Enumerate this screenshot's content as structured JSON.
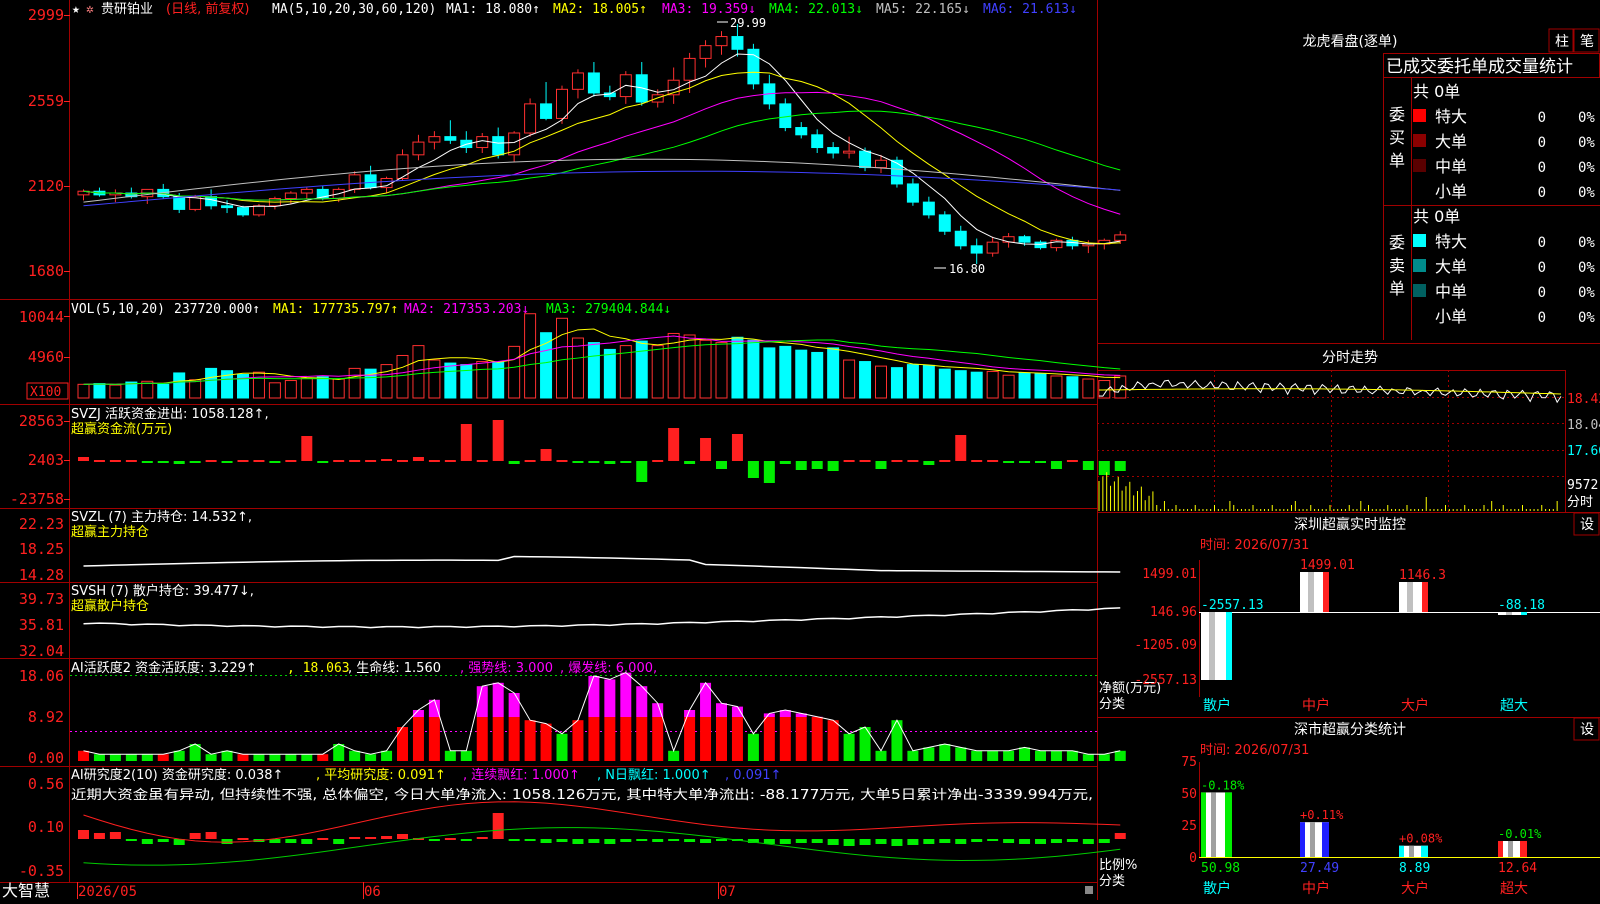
{
  "colors": {
    "up": "#ff3030",
    "down": "#00ffff",
    "grid": "#a00000",
    "label_red": "#ff2020",
    "ma1": "#ffffff",
    "ma2": "#ffff00",
    "ma3": "#ff00ff",
    "ma4": "#00ff00",
    "ma5": "#c0c0c0",
    "ma6": "#4040ff",
    "green_bar": "#00ee00"
  },
  "icons": {
    "star": "★",
    "gear": "✲"
  },
  "header": {
    "name": "贵研铂业",
    "period": "(日线, 前复权)",
    "ma_params": "MA(5,10,20,30,60,120)",
    "ma1": "MA1: 18.080↑",
    "ma2": "MA2: 18.005↑",
    "ma3": "MA3: 19.359↓",
    "ma4": "MA4: 22.013↓",
    "ma5": "MA5: 22.165↓",
    "ma6": "MA6: 21.613↓"
  },
  "price_axis": [
    "2999",
    "2559",
    "2120",
    "1680"
  ],
  "price_marks": {
    "high": "29.99",
    "low": "16.80"
  },
  "vol_panel": {
    "title": "VOL(5,10,20)",
    "v0": "237720.000↑",
    "ma1": "MA1: 177735.797↑",
    "ma2": "MA2: 217353.203↓",
    "ma3": "MA3: 279404.844↓",
    "axis": [
      "10044",
      "4960"
    ],
    "unit": "X100"
  },
  "svzj_panel": {
    "title": "SVZJ  活跃资金进出: 1058.128↑,",
    "subtitle": "超赢资金流(万元)",
    "axis": [
      "28563",
      "2403",
      "-23758"
    ]
  },
  "svzl_panel": {
    "title": "SVZL (7) 主力持仓: 14.532↑,",
    "subtitle": "超赢主力持仓",
    "axis": [
      "22.23",
      "18.25",
      "14.28"
    ]
  },
  "svsh_panel": {
    "title": "SVSH (7) 散户持仓: 39.477↓,",
    "subtitle": "超赢散户持仓",
    "axis": [
      "39.73",
      "35.81",
      "32.04"
    ]
  },
  "ai1_panel": {
    "title": "AI活跃度2 资金活跃度: 3.229↑",
    "v2": ", 18.063",
    "v3": ", 生命线: 1.560",
    "v4": ", 强势线: 3.000",
    "v5": ", 爆发线: 6.000,",
    "axis": [
      "18.06",
      "8.92",
      "0.00"
    ]
  },
  "ai2_panel": {
    "title": "AI研究度2(10) 资金研究度: 0.038↑",
    "v2": ", 平均研究度: 0.091↑",
    "v3": ", 连续飘红: 1.000↑",
    "v4": ", N日飘红: 1.000↑",
    "v5": ", 0.091↑",
    "comment": "近期大资金虽有异动, 但持续性不强, 总体偏空, 今日大单净流入: 1058.126万元, 其中特大单净流出: -88.177万元, 大单5日累计净出-3339.994万元, ",
    "axis": [
      "0.56",
      "0.10",
      "-0.35"
    ]
  },
  "bottom_bar": {
    "brand": "大智慧",
    "dates": [
      "2026/05",
      "06",
      "07"
    ]
  },
  "lhb": {
    "title": "龙虎看盘(逐单)",
    "btn1": "柱",
    "btn2": "笔",
    "subtitle": "已成交委托单成交量统计",
    "buy_label": "委买单",
    "sell_label": "委卖单",
    "buy_total": "共 0单",
    "sell_total": "共 0单",
    "buy_rows": [
      {
        "label": "特大",
        "count": "0",
        "pct": "0%"
      },
      {
        "label": "大单",
        "count": "0",
        "pct": "0%"
      },
      {
        "label": "中单",
        "count": "0",
        "pct": "0%"
      },
      {
        "label": "小单",
        "count": "0",
        "pct": "0%"
      }
    ],
    "sell_rows": [
      {
        "label": "特大",
        "count": "0",
        "pct": "0%"
      },
      {
        "label": "大单",
        "count": "0",
        "pct": "0%"
      },
      {
        "label": "中单",
        "count": "0",
        "pct": "0%"
      },
      {
        "label": "小单",
        "count": "0",
        "pct": "0%"
      }
    ]
  },
  "intraday": {
    "title": "分时走势",
    "axis": [
      "18.42",
      "18.04",
      "17.66"
    ],
    "vol_label": "9572",
    "vol_unit": "分时"
  },
  "sz_monitor": {
    "title": "深圳超赢实时监控",
    "btn": "设",
    "time": "时间: 2026/07/31",
    "axis": [
      "1499.01",
      "146.96",
      "-1205.09",
      "-2557.13"
    ],
    "y_label": "净额(万元)",
    "x_label": "分类",
    "cats": [
      "散户",
      "中户",
      "大户",
      "超大"
    ],
    "value_labels": [
      "-2557.13",
      "1499.01",
      "1146.3",
      "-88.18"
    ]
  },
  "sz_class": {
    "title": "深市超赢分类统计",
    "btn": "设",
    "time": "时间: 2026/07/31",
    "axis": [
      "75",
      "50",
      "25",
      "0"
    ],
    "y_label": "比例%",
    "x_label": "分类",
    "cats": [
      "散户",
      "中户",
      "大户",
      "超大"
    ],
    "pct_labels": [
      "-0.18%",
      "+0.11%",
      "+0.08%",
      "-0.01%"
    ],
    "value_labels": [
      "50.98",
      "27.49",
      "8.89",
      "12.64"
    ]
  },
  "chart_data": [
    {
      "type": "candlestick",
      "title": "贵研铂业 (日线, 前复权)",
      "ylim": [
        16.8,
        29.99
      ],
      "x_ticks": [
        "2026/05",
        "06",
        "07"
      ],
      "ohlc": [
        [
          20.6,
          20.9,
          20.3,
          20.8
        ],
        [
          20.8,
          21.0,
          20.5,
          20.6
        ],
        [
          20.6,
          20.9,
          20.2,
          20.7
        ],
        [
          20.7,
          21.0,
          20.4,
          20.5
        ],
        [
          20.5,
          20.9,
          20.1,
          20.9
        ],
        [
          20.9,
          21.2,
          20.4,
          20.5
        ],
        [
          20.5,
          20.7,
          19.6,
          19.8
        ],
        [
          19.8,
          20.6,
          19.7,
          20.5
        ],
        [
          20.5,
          20.9,
          19.8,
          20.0
        ],
        [
          20.0,
          20.3,
          19.6,
          19.9
        ],
        [
          19.9,
          20.0,
          19.4,
          19.5
        ],
        [
          19.5,
          20.1,
          19.4,
          20.0
        ],
        [
          20.0,
          20.5,
          19.8,
          20.4
        ],
        [
          20.4,
          20.8,
          20.1,
          20.7
        ],
        [
          20.7,
          21.0,
          20.4,
          20.9
        ],
        [
          20.9,
          21.1,
          20.3,
          20.4
        ],
        [
          20.4,
          21.0,
          20.2,
          20.9
        ],
        [
          20.9,
          21.9,
          20.7,
          21.7
        ],
        [
          21.7,
          22.2,
          20.9,
          21.0
        ],
        [
          21.0,
          21.6,
          20.7,
          21.5
        ],
        [
          21.5,
          23.1,
          21.4,
          22.8
        ],
        [
          22.8,
          23.9,
          22.5,
          23.5
        ],
        [
          23.5,
          24.1,
          23.1,
          23.8
        ],
        [
          23.8,
          24.7,
          23.4,
          23.6
        ],
        [
          23.6,
          24.1,
          22.9,
          23.2
        ],
        [
          23.2,
          24.0,
          22.9,
          23.8
        ],
        [
          23.8,
          24.3,
          22.6,
          22.8
        ],
        [
          22.8,
          24.1,
          22.4,
          24.0
        ],
        [
          24.0,
          25.9,
          23.8,
          25.6
        ],
        [
          25.6,
          26.8,
          24.7,
          24.8
        ],
        [
          24.8,
          26.6,
          24.5,
          26.4
        ],
        [
          26.4,
          27.5,
          25.9,
          27.3
        ],
        [
          27.3,
          27.9,
          26.0,
          26.2
        ],
        [
          26.2,
          26.6,
          25.8,
          26.0
        ],
        [
          26.0,
          27.4,
          25.6,
          27.2
        ],
        [
          27.2,
          27.9,
          25.5,
          25.7
        ],
        [
          25.7,
          26.4,
          25.4,
          26.1
        ],
        [
          26.1,
          27.6,
          25.6,
          26.9
        ],
        [
          26.9,
          28.4,
          26.2,
          28.1
        ],
        [
          28.1,
          29.1,
          27.6,
          28.8
        ],
        [
          28.8,
          29.6,
          28.3,
          29.3
        ],
        [
          29.3,
          29.99,
          28.2,
          28.6
        ],
        [
          28.6,
          28.9,
          26.4,
          26.7
        ],
        [
          26.7,
          27.2,
          25.3,
          25.6
        ],
        [
          25.6,
          25.9,
          24.1,
          24.3
        ],
        [
          24.3,
          24.6,
          23.7,
          23.9
        ],
        [
          23.9,
          24.2,
          22.9,
          23.2
        ],
        [
          23.2,
          23.5,
          22.6,
          22.9
        ],
        [
          22.9,
          23.8,
          22.6,
          23.0
        ],
        [
          23.0,
          23.2,
          21.9,
          22.1
        ],
        [
          22.1,
          22.8,
          21.8,
          22.5
        ],
        [
          22.5,
          22.7,
          21.0,
          21.2
        ],
        [
          21.2,
          21.5,
          20.0,
          20.2
        ],
        [
          20.2,
          20.5,
          19.3,
          19.5
        ],
        [
          19.5,
          19.7,
          18.4,
          18.6
        ],
        [
          18.6,
          18.9,
          17.6,
          17.8
        ],
        [
          17.8,
          18.2,
          16.8,
          17.4
        ],
        [
          17.4,
          18.3,
          17.2,
          18.0
        ],
        [
          18.0,
          18.5,
          17.7,
          18.3
        ],
        [
          18.3,
          18.4,
          17.8,
          18.0
        ],
        [
          18.0,
          18.1,
          17.6,
          17.7
        ],
        [
          17.7,
          18.2,
          17.5,
          18.1
        ],
        [
          18.1,
          18.3,
          17.6,
          17.8
        ],
        [
          17.8,
          18.1,
          17.4,
          17.9
        ],
        [
          17.9,
          18.2,
          17.6,
          18.1
        ],
        [
          18.1,
          18.6,
          17.9,
          18.4
        ]
      ],
      "ma_labels": [
        "MA1",
        "MA2",
        "MA3",
        "MA4",
        "MA5",
        "MA6"
      ]
    },
    {
      "type": "bar",
      "title": "VOL(5,10,20)",
      "axis_ticks": [
        "10044",
        "4960"
      ],
      "values": [
        1800,
        1900,
        1700,
        2100,
        2200,
        1800,
        3300,
        2400,
        3900,
        3600,
        3100,
        3400,
        2000,
        2300,
        2600,
        2800,
        2500,
        3900,
        3800,
        4400,
        5600,
        6900,
        5000,
        4600,
        4400,
        4800,
        4700,
        6800,
        11100,
        8600,
        10500,
        7900,
        7300,
        6400,
        6900,
        7500,
        6900,
        8500,
        8300,
        7600,
        7300,
        8000,
        7600,
        6600,
        6800,
        6300,
        6000,
        6600,
        5000,
        4800,
        4200,
        4000,
        4400,
        4300,
        3800,
        3600,
        3400,
        3500,
        3000,
        3300,
        3200,
        2900,
        2800,
        2500,
        2300,
        2900
      ],
      "up": [
        1,
        0,
        1,
        0,
        1,
        0,
        0,
        1,
        0,
        0,
        0,
        1,
        1,
        1,
        1,
        0,
        1,
        1,
        0,
        1,
        1,
        1,
        1,
        0,
        0,
        1,
        0,
        1,
        1,
        0,
        1,
        1,
        0,
        0,
        1,
        0,
        1,
        1,
        1,
        1,
        1,
        0,
        0,
        0,
        0,
        0,
        0,
        0,
        1,
        0,
        1,
        0,
        0,
        0,
        0,
        0,
        0,
        1,
        1,
        0,
        0,
        1,
        0,
        1,
        1,
        1
      ]
    },
    {
      "type": "bar",
      "title": "超赢资金流(万元)",
      "axis_ticks": [
        "28563",
        "2403",
        "-23758"
      ]
    },
    {
      "type": "line",
      "title": "超赢主力持仓",
      "axis_ticks": [
        "22.23",
        "18.25",
        "14.28"
      ]
    },
    {
      "type": "line",
      "title": "超赢散户持仓",
      "axis_ticks": [
        "39.73",
        "35.81",
        "32.04"
      ]
    },
    {
      "type": "bar",
      "title": "AI活跃度2",
      "axis_ticks": [
        "18.06",
        "8.92",
        "0.00"
      ]
    },
    {
      "type": "bar",
      "title": "AI研究度2(10)",
      "axis_ticks": [
        "0.56",
        "0.10",
        "-0.35"
      ]
    },
    {
      "type": "bar",
      "title": "深圳超赢实时监控",
      "ylabel": "净额(万元)",
      "xlabel": "分类",
      "categories": [
        "散户",
        "中户",
        "大户",
        "超大"
      ],
      "values": [
        -2557.13,
        1499.01,
        1146.3,
        -88.18
      ],
      "ylim": [
        -2557.13,
        1499.01
      ]
    },
    {
      "type": "bar",
      "title": "深市超赢分类统计",
      "ylabel": "比例%",
      "xlabel": "分类",
      "categories": [
        "散户",
        "中户",
        "大户",
        "超大"
      ],
      "values": [
        50.98,
        27.49,
        8.89,
        12.64
      ],
      "ylim": [
        0,
        75
      ]
    }
  ]
}
